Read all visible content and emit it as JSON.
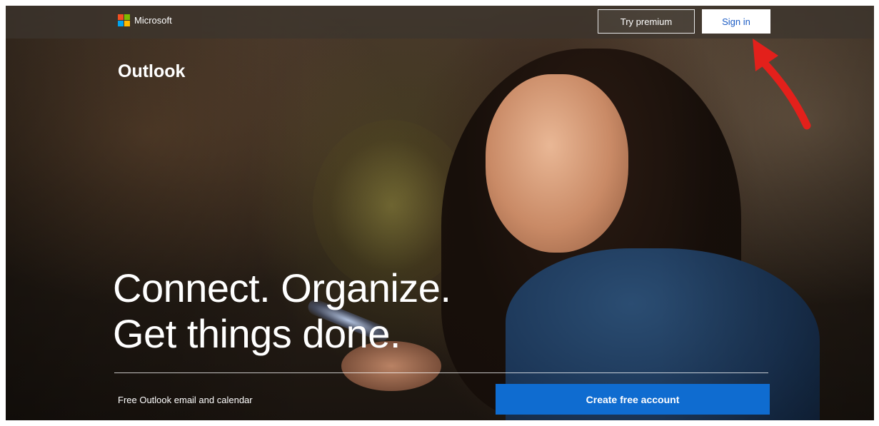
{
  "header": {
    "brand_name": "Microsoft",
    "brand_colors": [
      "#f25022",
      "#7fba00",
      "#00a4ef",
      "#ffb900"
    ],
    "try_premium_label": "Try premium",
    "sign_in_label": "Sign in"
  },
  "hero": {
    "product_name": "Outlook",
    "headline_line1": "Connect. Organize.",
    "headline_line2": "Get things done.",
    "tagline": "Free Outlook email and calendar",
    "cta_label": "Create free account"
  },
  "colors": {
    "cta_background": "#0f6cd0",
    "sign_in_text": "#1a5bc4",
    "annotation_arrow": "#e3201b"
  }
}
